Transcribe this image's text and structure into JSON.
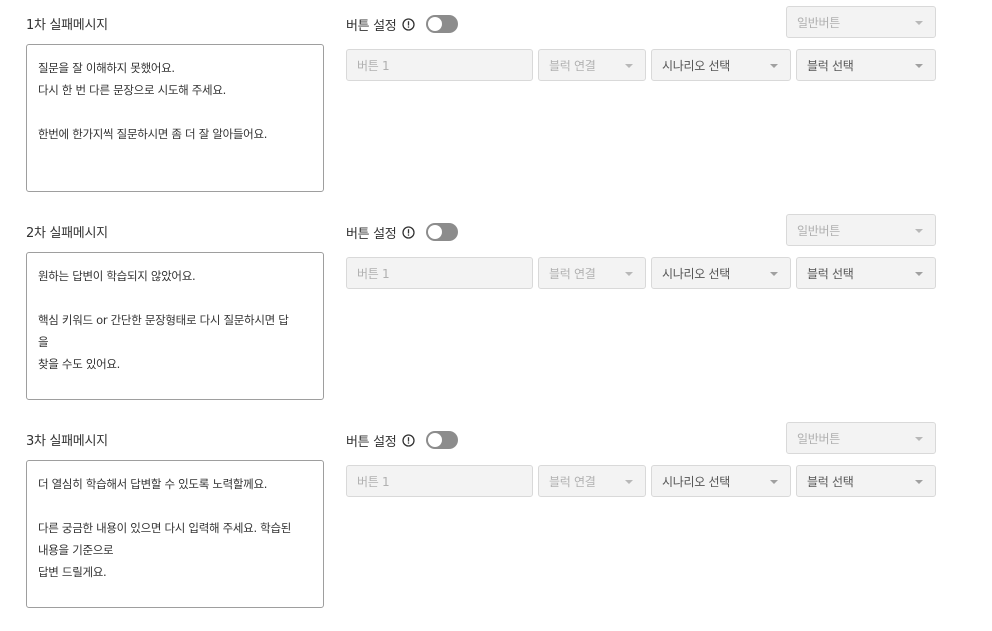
{
  "sections": [
    {
      "title": "1차 실패메시지",
      "message_lines": [
        "질문을 잘 이해하지 못했어요.",
        "다시 한 번 다른 문장으로 시도해 주세요.",
        "",
        "한번에 한가지씩 질문하시면 좀 더 잘 알아들어요."
      ],
      "button_setting_label": "버튼 설정",
      "button_type": "일반버튼",
      "button_name_placeholder": "버튼 1",
      "link_type": "블럭 연결",
      "scenario": "시나리오 선택",
      "block": "블럭 선택"
    },
    {
      "title": "2차 실패메시지",
      "message_lines": [
        "원하는 답변이 학습되지 않았어요.",
        "",
        "핵심 키워드 or 간단한 문장형태로 다시 질문하시면 답",
        "을",
        "찾을 수도 있어요."
      ],
      "button_setting_label": "버튼 설정",
      "button_type": "일반버튼",
      "button_name_placeholder": "버튼 1",
      "link_type": "블럭 연결",
      "scenario": "시나리오 선택",
      "block": "블럭 선택"
    },
    {
      "title": "3차 실패메시지",
      "message_lines": [
        "더 열심히 학습해서 답변할 수 있도록 노력할께요.",
        "",
        "다른 궁금한 내용이 있으면 다시 입력해 주세요. 학습된",
        "내용을 기준으로",
        "답변 드릴게요."
      ],
      "button_setting_label": "버튼 설정",
      "button_type": "일반버튼",
      "button_name_placeholder": "버튼 1",
      "link_type": "블럭 연결",
      "scenario": "시나리오 선택",
      "block": "블럭 선택"
    }
  ],
  "toggle_state": "off",
  "icons": {
    "info": "info-icon",
    "dropdown": "chevron-down-icon"
  },
  "colors": {
    "toggle_off": "#8c8c8c",
    "field_bg": "#f3f3f3",
    "border": "#9e9e9e"
  }
}
